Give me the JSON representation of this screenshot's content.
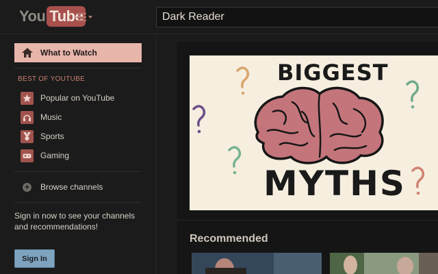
{
  "header": {
    "logo_you": "You",
    "logo_tube": "Tube",
    "search_value": "Dark Reader"
  },
  "sidebar": {
    "what_to_watch": "What to Watch",
    "section_title": "BEST OF YOUTUBE",
    "items": [
      {
        "label": "Popular on YouTube",
        "icon": "star-icon"
      },
      {
        "label": "Music",
        "icon": "headphones-icon"
      },
      {
        "label": "Sports",
        "icon": "medal-icon"
      },
      {
        "label": "Gaming",
        "icon": "gamepad-icon"
      }
    ],
    "browse": "Browse channels",
    "signin_text": "Sign in now to see your channels and recommendations!",
    "signin_button": "Sign In"
  },
  "main": {
    "feature_title_top": "BIGGEST",
    "feature_title_bottom": "MYTHS",
    "recommended_title": "Recommended"
  },
  "colors": {
    "accent": "#a1534e",
    "highlight": "#e8b5ab",
    "signin_button": "#7ea3bf"
  }
}
